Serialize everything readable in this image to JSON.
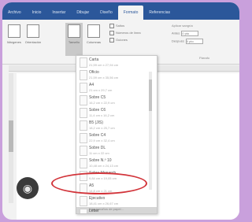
{
  "ribbon": {
    "tabs": [
      "Archivo",
      "Inicio",
      "Insertar",
      "Dibujar",
      "Diseño",
      "Formato",
      "Referencias"
    ],
    "active_tab_index": 5,
    "buttons": {
      "margins": "Márgenes",
      "orientation": "Orientación",
      "size": "Tamaño",
      "columns": "Columnas"
    },
    "checks": [
      "Saltos",
      "Números de línea",
      "Guiones"
    ],
    "indent_label": "Aplicar sangría",
    "before_label": "Antes",
    "before_value": "0 pto",
    "after_label": "Después",
    "after_value": "0 pto",
    "group_label": "Párrafo"
  },
  "dropdown": {
    "items": [
      {
        "name": "Carta",
        "size": "21,59 cm x 27,94 cm"
      },
      {
        "name": "Oficio",
        "size": "21,59 cm x 35,56 cm"
      },
      {
        "name": "A4",
        "size": "21 cm x 29,7 cm"
      },
      {
        "name": "Sobre C5",
        "size": "16,2 cm x 22,9 cm"
      },
      {
        "name": "Sobre C6",
        "size": "11,4 cm x 16,2 cm"
      },
      {
        "name": "B5 (JIS)",
        "size": "18,2 cm x 25,7 cm"
      },
      {
        "name": "Sobre C4",
        "size": "22,9 cm x 32,4 cm"
      },
      {
        "name": "Sobre DL",
        "size": "11 cm x 22 cm"
      },
      {
        "name": "Sobre N.º 10",
        "size": "10,48 cm x 24,13 cm"
      },
      {
        "name": "Sobre Monarch",
        "size": "9,84 cm x 19,05 cm"
      },
      {
        "name": "A5",
        "size": "14,8 cm x 21 cm"
      },
      {
        "name": "Ejecutivo",
        "size": "18,41 cm x 26,67 cm"
      },
      {
        "name": "Letter",
        "size": "21,59 cm x 27,94 cm"
      }
    ],
    "selected_index": 12,
    "footer": "Más tamaños de papel..."
  },
  "overlay": {
    "icon": "screenshot-icon"
  },
  "colors": {
    "accent": "#2b579a",
    "highlight": "#d2343a",
    "background": "#c9a0dc"
  }
}
